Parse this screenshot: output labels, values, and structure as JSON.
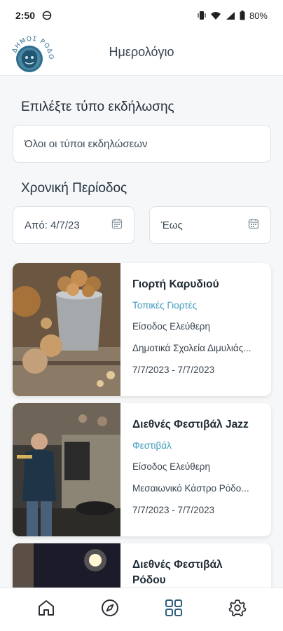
{
  "status": {
    "time": "2:50",
    "battery": "80%"
  },
  "header": {
    "title": "Ημερολόγιο",
    "logo_text": "ΔΗΜΟΣ ΡΟΔΟΥ"
  },
  "filters": {
    "event_type_label": "Επιλέξτε τύπο εκδήλωσης",
    "event_type_value": "Όλοι οι τύποι εκδηλώσεων",
    "period_label": "Χρονική Περίοδος",
    "from_value": "Από: 4/7/23",
    "to_placeholder": "Έως"
  },
  "events": [
    {
      "title": "Γιορτή Καρυδιού",
      "category": "Τοπικές Γιορτές",
      "entry": "Είσοδος Ελεύθερη",
      "location": "Δημοτικά Σχολεία Διμυλιάς...",
      "dates": "7/7/2023 - 7/7/2023"
    },
    {
      "title": "Διεθνές Φεστιβάλ Jazz",
      "category": "Φεστιβάλ",
      "entry": "Είσοδος Ελεύθερη",
      "location": "Μεσαιωνικό Κάστρο Ρόδο...",
      "dates": "7/7/2023 - 7/7/2023"
    },
    {
      "title": "Διεθνές Φεστιβάλ Ρόδου",
      "category": "",
      "entry": "",
      "location": "",
      "dates": ""
    }
  ],
  "nav": {
    "items": [
      "home-icon",
      "compass-icon",
      "grid-icon",
      "gear-icon"
    ],
    "active": "grid-icon",
    "active_color": "#2f5f7a",
    "inactive_color": "#2b2f33"
  }
}
